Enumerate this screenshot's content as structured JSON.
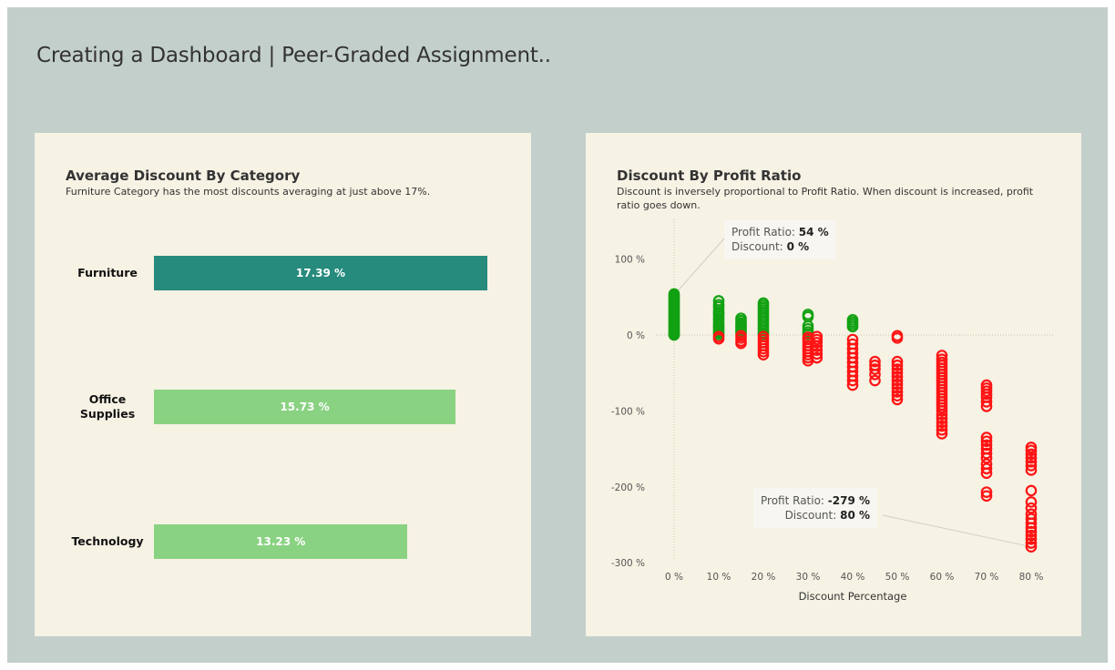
{
  "page_title": "Creating a Dashboard | Peer-Graded Assignment..",
  "left_panel": {
    "title": "Average Discount By Category",
    "subtitle": "Furniture Category has the most discounts averaging at just above 17%."
  },
  "right_panel": {
    "title": "Discount By Profit Ratio",
    "subtitle": "Discount is inversely proportional to Profit Ratio. When discount is increased, profit ratio goes down."
  },
  "tooltips": [
    {
      "ratio_label": "Profit Ratio:",
      "ratio_value": "54 %",
      "discount_label": "Discount:",
      "discount_value": "0 %"
    },
    {
      "ratio_label": "Profit Ratio:",
      "ratio_value": "-279 %",
      "discount_label": "Discount:",
      "discount_value": "80 %"
    }
  ],
  "colors": {
    "positive": "#12a112",
    "negative": "#ff1414",
    "furniture_bar": "#268a7d",
    "other_bar": "#89d282"
  },
  "chart_data": [
    {
      "type": "bar",
      "orientation": "horizontal",
      "categories": [
        "Furniture",
        "Office Supplies",
        "Technology"
      ],
      "category_display": [
        [
          "Furniture"
        ],
        [
          "Office",
          "Supplies"
        ],
        [
          "Technology"
        ]
      ],
      "values": [
        17.39,
        15.73,
        13.23
      ],
      "value_labels": [
        "17.39 %",
        "15.73 %",
        "13.23 %"
      ],
      "xlim": [
        0,
        18
      ],
      "grid": false
    },
    {
      "type": "scatter",
      "xlabel": "Discount Percentage",
      "ylabel": "",
      "xlim": [
        -7,
        85
      ],
      "ylim": [
        -315,
        140
      ],
      "x_ticks": [
        0,
        10,
        20,
        30,
        40,
        50,
        60,
        70,
        80
      ],
      "x_tick_labels": [
        "0 %",
        "10 %",
        "20 %",
        "30 %",
        "40 %",
        "50 %",
        "60 %",
        "70 %",
        "80 %"
      ],
      "y_ticks": [
        100,
        0,
        -100,
        -200,
        -300
      ],
      "y_tick_labels": [
        "100 %",
        "0 %",
        "-100 %",
        "-200 %",
        "-300 %"
      ],
      "reference_lines": {
        "x": 0,
        "y": 0
      },
      "groups": [
        {
          "x": 0,
          "y": [
            54,
            52,
            50,
            48,
            46,
            44,
            42,
            40,
            38,
            36,
            34,
            32,
            30,
            28,
            26,
            24,
            22,
            20,
            18,
            16,
            14,
            12,
            10,
            8,
            6,
            4,
            2,
            1,
            0
          ]
        },
        {
          "x": 10,
          "y": [
            45,
            40,
            37,
            33,
            30,
            28,
            25,
            22,
            20,
            17,
            14,
            12,
            10,
            8,
            5,
            3,
            1,
            -2,
            -5
          ]
        },
        {
          "x": 15,
          "y": [
            22,
            19,
            16,
            14,
            12,
            10,
            8,
            6,
            4,
            2,
            -1,
            -4,
            -8,
            -11
          ]
        },
        {
          "x": 20,
          "y": [
            42,
            39,
            36,
            33,
            30,
            27,
            24,
            21,
            18,
            15,
            12,
            9,
            6,
            3,
            1,
            -2,
            -6,
            -10,
            -14,
            -18,
            -22,
            -26
          ]
        },
        {
          "x": 30,
          "y": [
            27,
            24,
            12,
            8,
            4,
            1,
            -3,
            -6,
            -10,
            -14,
            -18,
            -22,
            -26,
            -30,
            -34
          ]
        },
        {
          "x": 32,
          "y": [
            -2,
            -6,
            -10,
            -15,
            -20,
            -25,
            -30
          ]
        },
        {
          "x": 40,
          "y": [
            20,
            17,
            14,
            11,
            -6,
            -12,
            -18,
            -24,
            -30,
            -36,
            -42,
            -48,
            -54,
            -60,
            -66
          ]
        },
        {
          "x": 45,
          "y": [
            -35,
            -40,
            -45,
            -52,
            -60
          ]
        },
        {
          "x": 50,
          "y": [
            -1,
            -4,
            -35,
            -40,
            -45,
            -50,
            -55,
            -60,
            -65,
            -70,
            -75,
            -80,
            -85
          ]
        },
        {
          "x": 60,
          "y": [
            -27,
            -32,
            -36,
            -40,
            -44,
            -48,
            -52,
            -56,
            -60,
            -64,
            -68,
            -72,
            -76,
            -80,
            -84,
            -88,
            -92,
            -96,
            -100,
            -105,
            -110,
            -115,
            -120,
            -125,
            -130
          ]
        },
        {
          "x": 70,
          "y": [
            -66,
            -70,
            -74,
            -78,
            -82,
            -88,
            -94,
            -135,
            -140,
            -145,
            -150,
            -156,
            -162,
            -170,
            -176,
            -182,
            -207,
            -212
          ]
        },
        {
          "x": 80,
          "y": [
            -148,
            -152,
            -157,
            -162,
            -167,
            -172,
            -178,
            -205,
            -220,
            -228,
            -236,
            -242,
            -248,
            -254,
            -259,
            -264,
            -269,
            -274,
            -279
          ]
        }
      ]
    }
  ]
}
